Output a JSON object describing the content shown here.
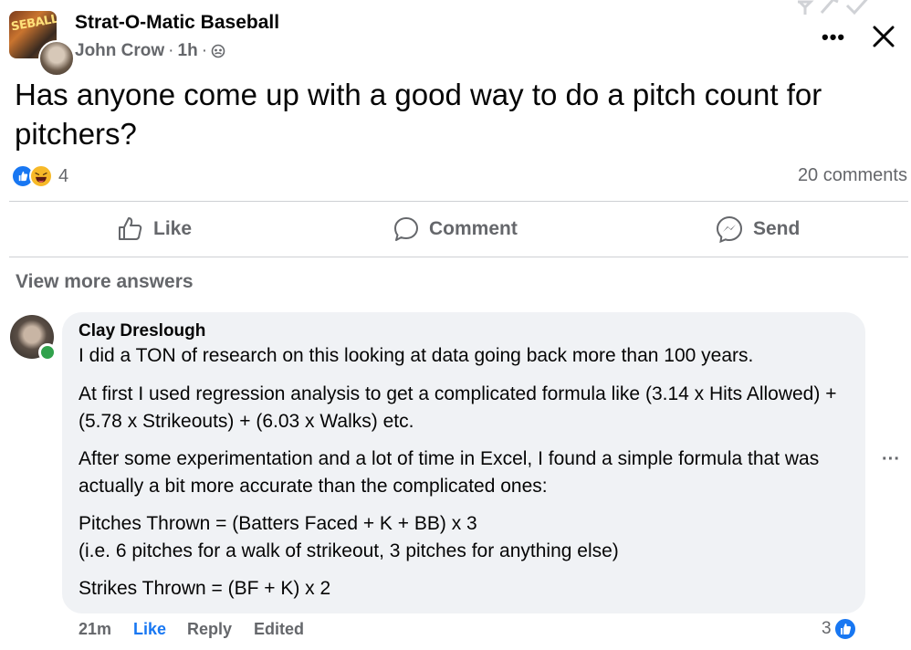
{
  "post": {
    "group_name": "Strat-O-Matic Baseball",
    "group_avatar_text": "SEBALL",
    "author": "John Crow",
    "time": "1h",
    "separator": "·",
    "question": "Has anyone come up with a good way to do a pitch count for pitchers?",
    "reaction_count": "4",
    "comments_count": "20 comments",
    "more_icon": "more-horizontal-icon",
    "close_icon": "close-icon"
  },
  "actions": {
    "like": "Like",
    "comment": "Comment",
    "send": "Send"
  },
  "view_more": "View more answers",
  "comment": {
    "author": "Clay Dreslough",
    "paragraphs": [
      "I did a TON of research on this looking at data going back more than 100 years.",
      "At first I used regression analysis to get a complicated formula like (3.14 x Hits Allowed) + (5.78 x Strikeouts) + (6.03 x Walks) etc.",
      "After some experimentation and a lot of time in Excel, I found a simple formula that was actually a bit more accurate than the complicated ones:",
      "Pitches Thrown = (Batters Faced + K + BB) x 3",
      "(i.e. 6 pitches for a walk of strikeout, 3 pitches for anything else)",
      "Strikes Thrown = (BF + K) x 2"
    ],
    "time": "21m",
    "like": "Like",
    "reply": "Reply",
    "edited": "Edited",
    "reaction_count": "3",
    "more": "···"
  },
  "colors": {
    "accent": "#1877f2",
    "muted": "#65676b",
    "bubble": "#f0f2f5",
    "online": "#31a24c",
    "haha": "#f7b928"
  }
}
